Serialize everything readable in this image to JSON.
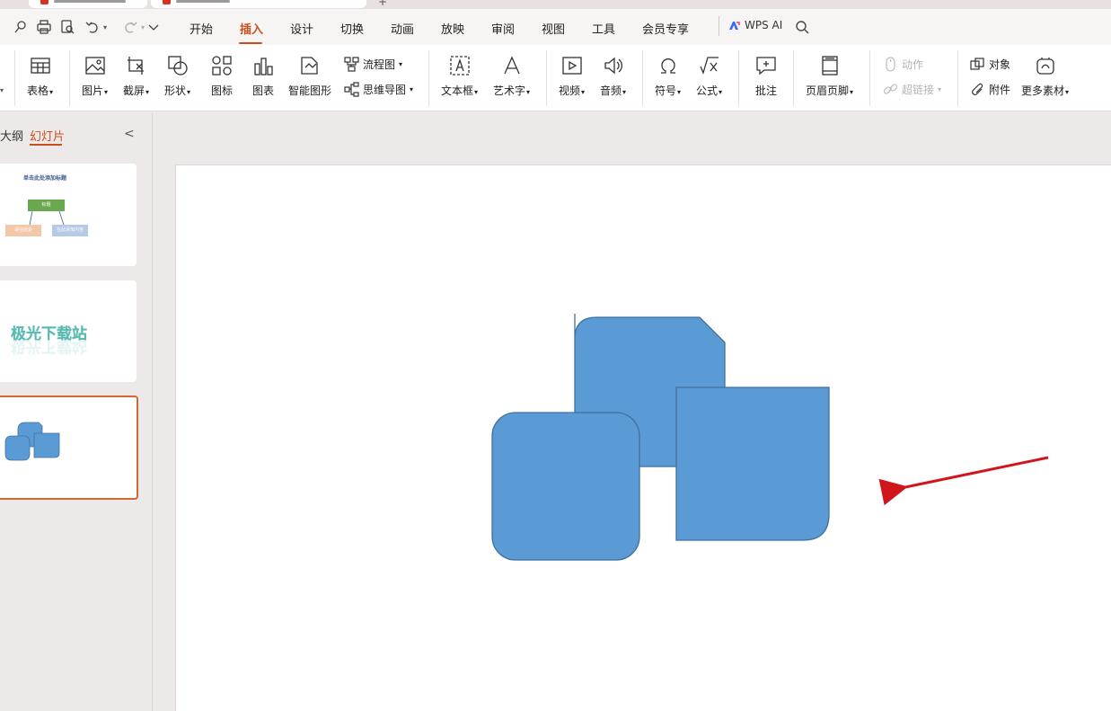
{
  "colors": {
    "accent": "#c8501f",
    "shape_fill": "#5b9bd5",
    "shape_stroke": "#41719c",
    "arrow": "#d0161c"
  },
  "quick_access": {
    "icons": [
      "pin-icon",
      "print-icon",
      "print-preview-icon",
      "undo-icon",
      "redo-icon",
      "more-icon"
    ]
  },
  "menu": {
    "items": [
      "开始",
      "插入",
      "设计",
      "切换",
      "动画",
      "放映",
      "审阅",
      "视图",
      "工具",
      "会员专享"
    ],
    "active": "插入",
    "ai_label": "WPS AI"
  },
  "ribbon": {
    "table": "表格",
    "picture": "图片",
    "screenshot": "截屏",
    "shape": "形状",
    "icon": "图标",
    "chart": "图表",
    "smartart": "智能图形",
    "flowchart": "流程图",
    "mindmap": "思维导图",
    "textbox": "文本框",
    "wordart": "艺术字",
    "video": "视频",
    "audio": "音频",
    "symbol": "符号",
    "formula": "公式",
    "comment": "批注",
    "header_footer": "页眉页脚",
    "action": "动作",
    "hyperlink": "超链接",
    "object": "对象",
    "attachment": "附件",
    "more_assets": "更多素材"
  },
  "panel": {
    "outline_tab": "大纲",
    "slides_tab": "幻灯片",
    "thumb1": {
      "title": "单击此处添加标题",
      "node_top": "标题",
      "node_left": "请在此处",
      "node_right": "在此添加内容"
    },
    "thumb2": {
      "text": "极光下载站"
    }
  }
}
